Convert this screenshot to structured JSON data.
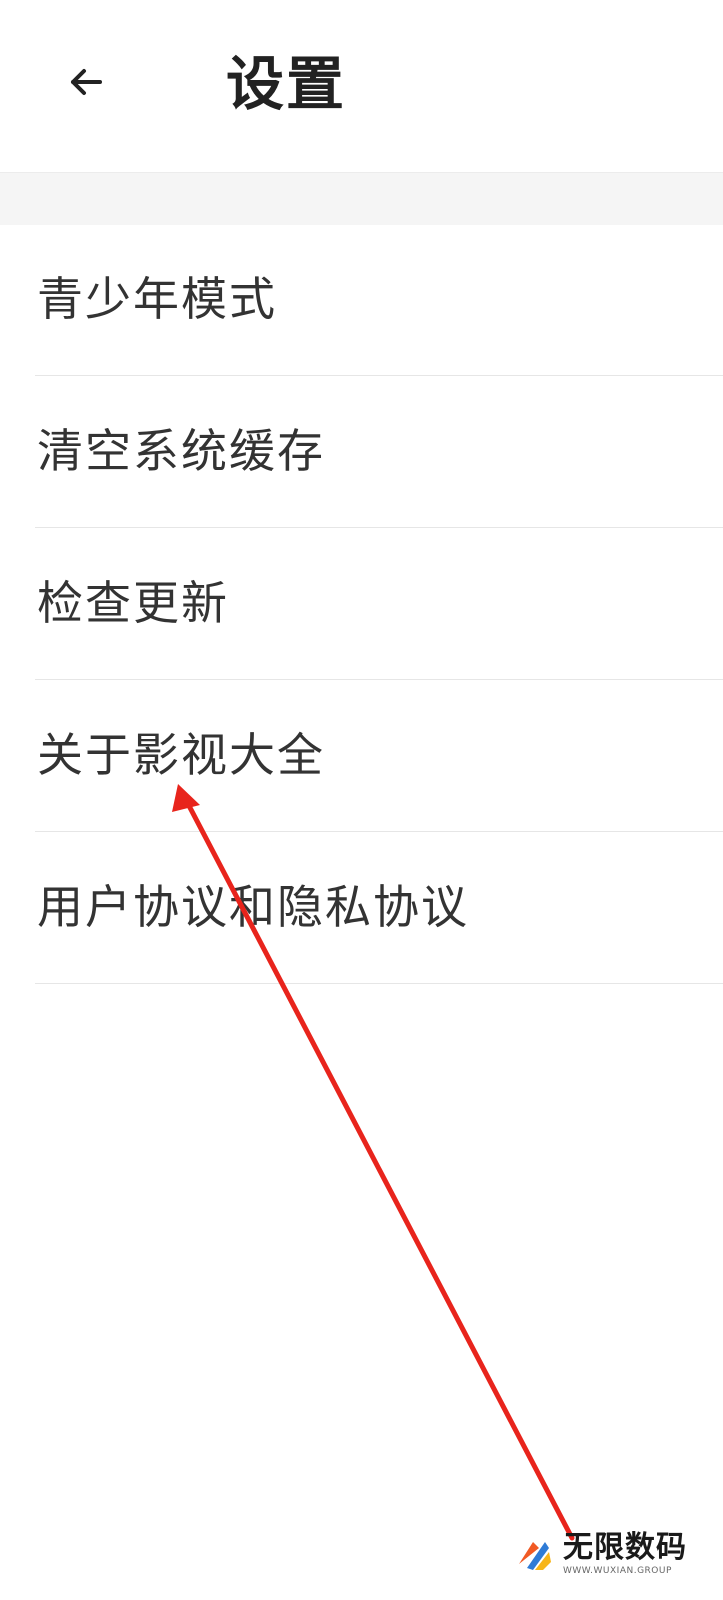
{
  "header": {
    "back_icon": "arrow-left-icon",
    "title": "设置"
  },
  "menu": {
    "items": [
      {
        "label": "青少年模式"
      },
      {
        "label": "清空系统缓存"
      },
      {
        "label": "检查更新"
      },
      {
        "label": "关于影视大全"
      },
      {
        "label": "用户协议和隐私协议"
      }
    ]
  },
  "annotation": {
    "arrow_color": "#e8241c"
  },
  "watermark": {
    "main": "无限数码",
    "sub": "WWW.WUXIAN.GROUP"
  },
  "colors": {
    "background": "#ffffff",
    "gap_band": "#f5f5f5",
    "divider": "#e6e6e6",
    "text": "#333333"
  }
}
